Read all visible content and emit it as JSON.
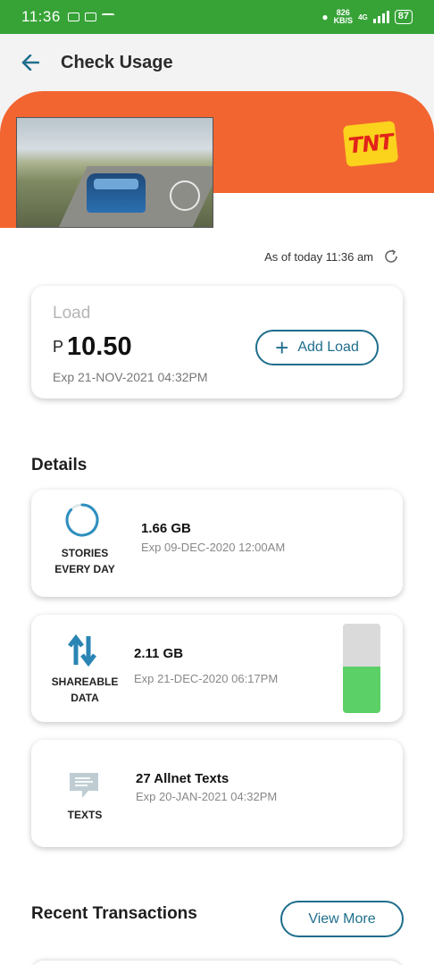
{
  "status_bar": {
    "time": "11:36",
    "net_speed_value": "826",
    "net_speed_unit": "KB/S",
    "network": "4G",
    "battery": "87"
  },
  "header": {
    "title": "Check Usage",
    "back_icon": "back-arrow-icon"
  },
  "banner": {
    "brand": "TNT",
    "image": "racing-game-promo"
  },
  "as_of": {
    "text": "As of today 11:36 am",
    "icon": "refresh-icon"
  },
  "load": {
    "label": "Load",
    "currency": "P",
    "amount": "10.50",
    "expiry": "Exp 21-NOV-2021 04:32PM",
    "add_button": "Add Load"
  },
  "details": {
    "title": "Details",
    "items": [
      {
        "label_line1": "STORIES",
        "label_line2": "EVERY DAY",
        "amount": "1.66 GB",
        "expiry": "Exp 09-DEC-2020 12:00AM",
        "icon": "progress-ring-icon"
      },
      {
        "label_line1": "SHAREABLE",
        "label_line2": "DATA",
        "amount": "2.11 GB",
        "expiry": "Exp 21-DEC-2020 06:17PM",
        "icon": "transfer-arrows-icon",
        "remaining_fraction": 0.52
      },
      {
        "label_line1": "TEXTS",
        "label_line2": "",
        "amount": "27 Allnet Texts",
        "expiry": "Exp 20-JAN-2021 04:32PM",
        "icon": "message-icon"
      }
    ]
  },
  "transactions": {
    "title": "Recent Transactions",
    "view_more": "View More"
  },
  "colors": {
    "accent": "#1f6e8c",
    "brand_orange": "#f26531",
    "status_green": "#37a337",
    "meter_green": "#5ad067"
  }
}
